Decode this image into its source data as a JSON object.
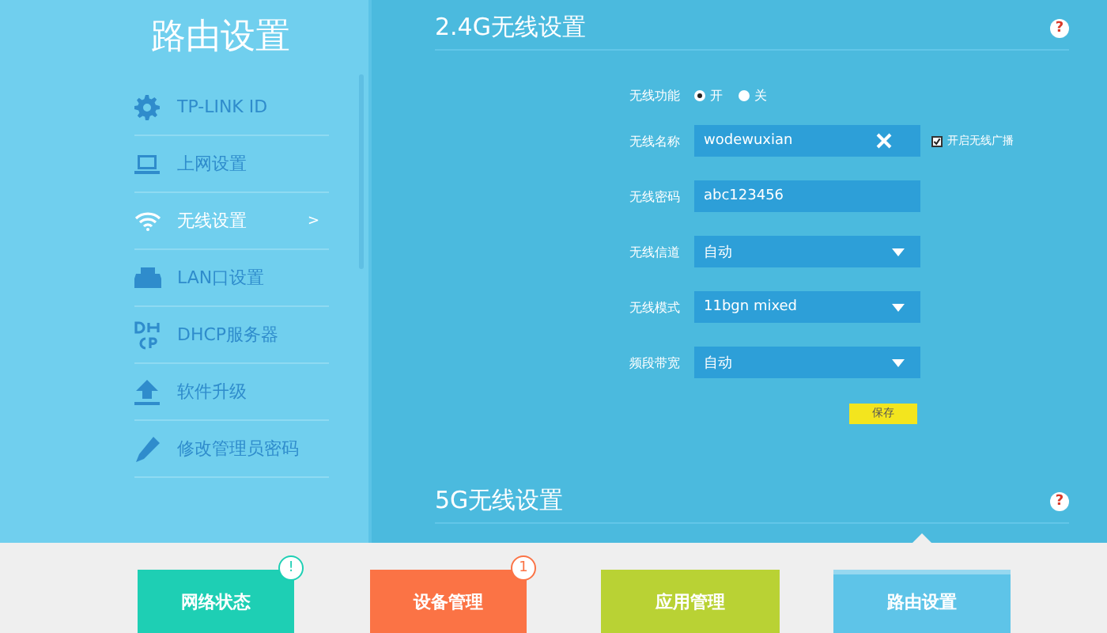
{
  "sidebar": {
    "title": "路由设置",
    "items": [
      {
        "label": "TP-LINK ID",
        "selected": false
      },
      {
        "label": "上网设置",
        "selected": false
      },
      {
        "label": "无线设置",
        "selected": true,
        "arrow": ">"
      },
      {
        "label": "LAN口设置",
        "selected": false
      },
      {
        "label": "DHCP服务器",
        "selected": false
      },
      {
        "label": "软件升级",
        "selected": false
      },
      {
        "label": "修改管理员密码",
        "selected": false
      }
    ]
  },
  "sections": [
    {
      "title": "2.4G无线设置",
      "help": "?",
      "fields": [
        {
          "kind": "radio",
          "label": "无线功能",
          "options": [
            {
              "label": "开",
              "selected": true
            },
            {
              "label": "关",
              "selected": false
            }
          ]
        },
        {
          "kind": "text",
          "label": "无线名称",
          "value": "wodewuxian",
          "clearable": true,
          "checkbox": {
            "label": "开启无线广播",
            "checked": true
          }
        },
        {
          "kind": "text",
          "label": "无线密码",
          "value": "abc123456"
        },
        {
          "kind": "select",
          "label": "无线信道",
          "value": "自动"
        },
        {
          "kind": "select",
          "label": "无线模式",
          "value": "11bgn mixed"
        },
        {
          "kind": "select",
          "label": "频段带宽",
          "value": "自动"
        }
      ],
      "save": "保存"
    },
    {
      "title": "5G无线设置",
      "help": "?"
    }
  ],
  "tabs": [
    {
      "label": "网络状态",
      "color": "#1ecfb4",
      "badge": "!",
      "selected": false
    },
    {
      "label": "设备管理",
      "color": "#fb7345",
      "badge": "1",
      "selected": false
    },
    {
      "label": "应用管理",
      "color": "#b9d234",
      "selected": false
    },
    {
      "label": "路由设置",
      "color": "#5ec4e8",
      "selected": true
    }
  ]
}
